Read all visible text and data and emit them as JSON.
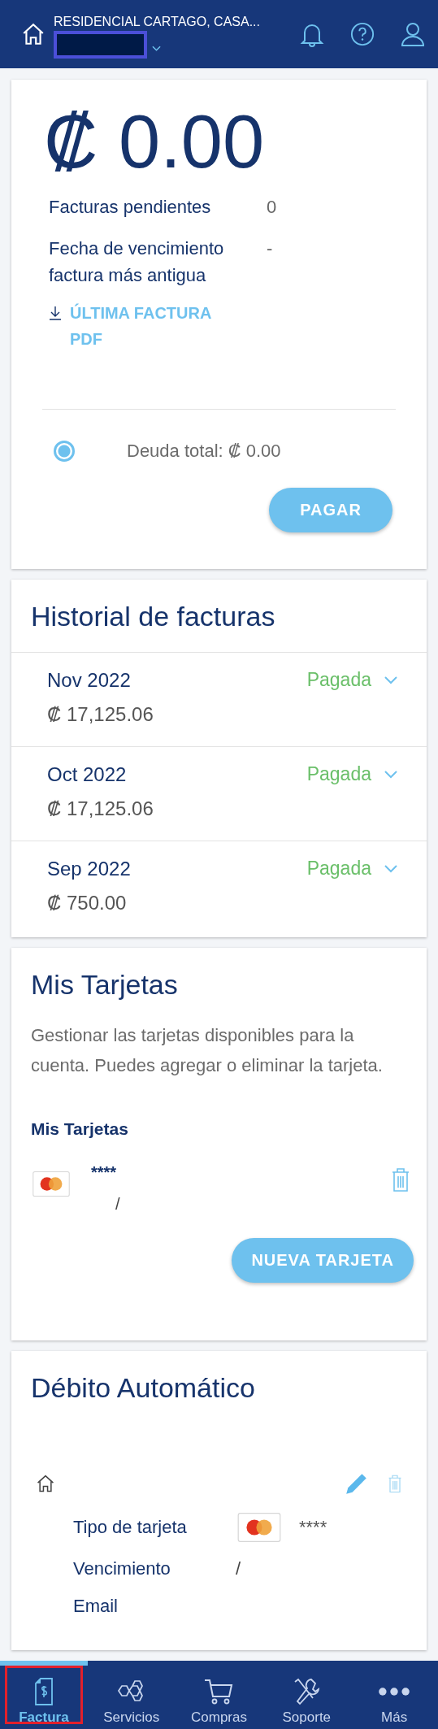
{
  "header": {
    "address": "RESIDENCIAL CARTAGO, CASA..."
  },
  "balance": {
    "amount": "₡ 0.00",
    "details": [
      {
        "label": "Facturas pendientes",
        "value": "0"
      },
      {
        "label": "Fecha de vencimiento factura más antigua",
        "value": "-"
      }
    ],
    "download_link": "ÚLTIMA FACTURA PDF",
    "debt_option": {
      "label": "Deuda total: ₡ 0.00",
      "selected": true
    },
    "pay_button": "PAGAR"
  },
  "history": {
    "title": "Historial de facturas",
    "rows": [
      {
        "period": "Nov 2022",
        "amount": "₡ 17,125.06",
        "status": "Pagada",
        "expanded": false
      },
      {
        "period": "Oct 2022",
        "amount": "₡ 17,125.06",
        "status": "Pagada",
        "expanded": false
      },
      {
        "period": "Sep 2022",
        "amount": "₡ 750.00",
        "status": "Pagada",
        "expanded": false
      }
    ]
  },
  "cards": {
    "title": "Mis Tarjetas",
    "description": "Gestionar las tarjetas disponibles para la cuenta. Puedes agregar o eliminar la tarjeta.",
    "subtitle": "Mis Tarjetas",
    "items": [
      {
        "number": "****",
        "expiry": "/"
      }
    ],
    "new_button": "NUEVA TARJETA"
  },
  "auto_debit": {
    "title": "Débito Automático",
    "fields": [
      {
        "kind": "card",
        "label": "Tipo de tarjeta",
        "value": "****"
      },
      {
        "kind": "text",
        "label": "Vencimiento",
        "value": "/"
      },
      {
        "kind": "text",
        "label": "Email"
      }
    ]
  },
  "nav": [
    {
      "label": "Factura",
      "selected": true
    },
    {
      "label": "Servicios",
      "selected": false
    },
    {
      "label": "Compras",
      "selected": false
    },
    {
      "label": "Soporte",
      "selected": false
    },
    {
      "label": "Más",
      "selected": false
    }
  ]
}
